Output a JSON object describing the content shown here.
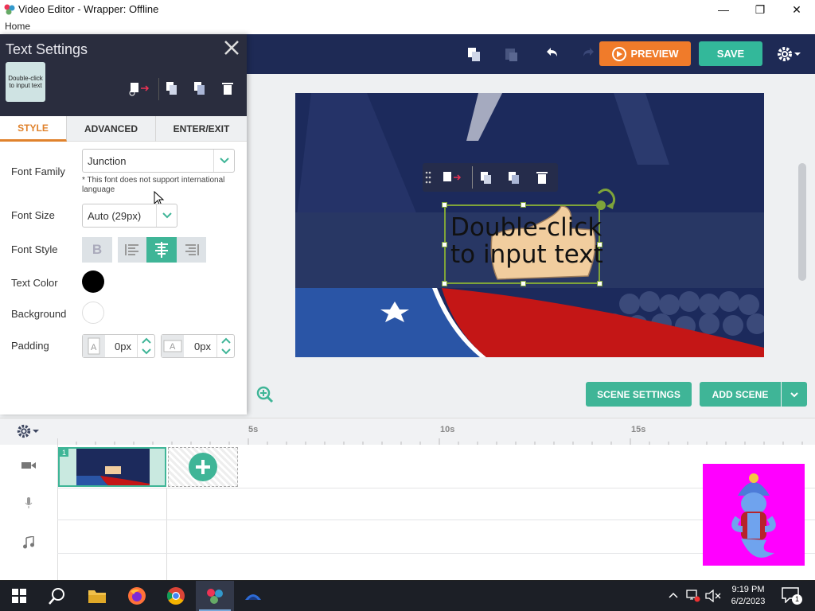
{
  "window": {
    "title": "Video Editor - Wrapper: Offline",
    "minimize": "—",
    "maximize": "❐",
    "close": "✕"
  },
  "menu": {
    "home": "Home"
  },
  "toolbar": {
    "preview_label": "PREVIEW",
    "save_label": "SAVE"
  },
  "panel": {
    "title": "Text Settings",
    "thumb_text": "Double-click to input text",
    "tabs": [
      {
        "label": "STYLE",
        "active": true
      },
      {
        "label": "ADVANCED",
        "active": false
      },
      {
        "label": "ENTER/EXIT",
        "active": false
      }
    ],
    "font_family": {
      "label": "Font Family",
      "value": "Junction",
      "note": "* This font does not support international language"
    },
    "font_size": {
      "label": "Font Size",
      "value": "Auto (29px)"
    },
    "font_style": {
      "label": "Font Style",
      "bold": "B",
      "selected_align": "center"
    },
    "text_color": {
      "label": "Text Color",
      "color": "#000000"
    },
    "background": {
      "label": "Background",
      "color": "#ffffff"
    },
    "padding": {
      "label": "Padding",
      "vertical": "0px",
      "horizontal": "0px"
    }
  },
  "stage": {
    "text": "Double-click\nto input text"
  },
  "buttons": {
    "scene_settings": "SCENE SETTINGS",
    "add_scene": "ADD SCENE"
  },
  "timeline": {
    "ticks": [
      "5s",
      "10s",
      "15s"
    ],
    "scene_number": "1"
  },
  "taskbar": {
    "time": "9:19 PM",
    "date": "6/2/2023",
    "notifications": "1"
  },
  "colors": {
    "accent_teal": "#3fb597",
    "accent_orange": "#f07b2a",
    "tab_active": "#e0822c",
    "header_dark": "#1e2a55"
  }
}
